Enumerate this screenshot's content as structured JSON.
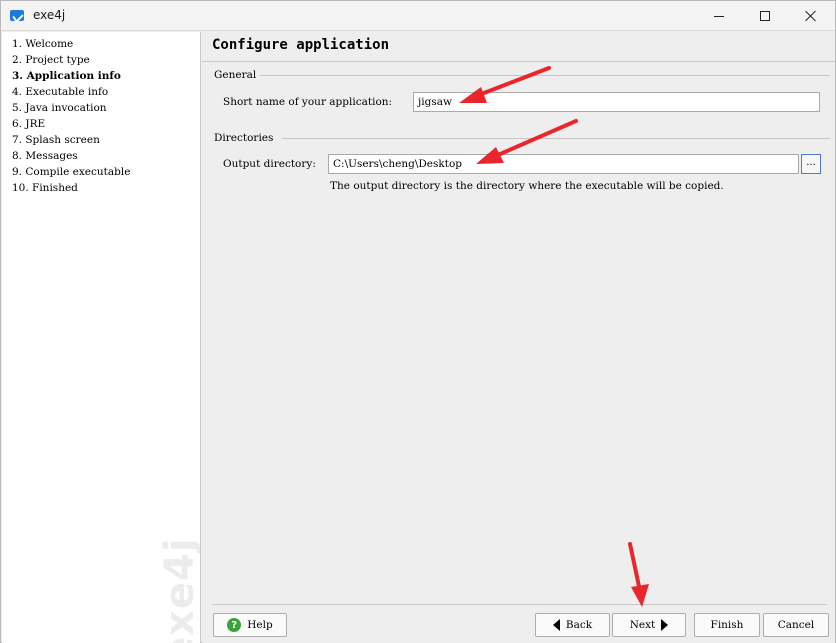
{
  "window": {
    "title": "exe4j",
    "icon": "exe4j-app-icon"
  },
  "sidebar": {
    "steps": [
      {
        "label": "1.  Welcome",
        "active": false
      },
      {
        "label": "2.  Project type",
        "active": false
      },
      {
        "label": "3.  Application info",
        "active": true
      },
      {
        "label": "4.  Executable info",
        "active": false
      },
      {
        "label": "5.  Java invocation",
        "active": false
      },
      {
        "label": "6.  JRE",
        "active": false
      },
      {
        "label": "7.  Splash screen",
        "active": false
      },
      {
        "label": "8.  Messages",
        "active": false
      },
      {
        "label": "9.  Compile executable",
        "active": false
      },
      {
        "label": "10.  Finished",
        "active": false
      }
    ],
    "watermark": "exe4j"
  },
  "main": {
    "heading": "Configure application",
    "general": {
      "group_label": "General",
      "short_name_label": "Short name of your application:",
      "short_name_value": "jigsaw"
    },
    "directories": {
      "group_label": "Directories",
      "output_label": "Output directory:",
      "output_value": "C:\\Users\\cheng\\Desktop",
      "browse_label": "...",
      "hint": "The output directory is the directory where the executable will be copied."
    }
  },
  "footer": {
    "help_label": "Help",
    "back_label": "Back",
    "next_label": "Next",
    "finish_label": "Finish",
    "cancel_label": "Cancel"
  },
  "colors": {
    "annotation_arrow": "#e8262b",
    "help_icon": "#3aa23a",
    "accent": "#1f7ae0"
  }
}
